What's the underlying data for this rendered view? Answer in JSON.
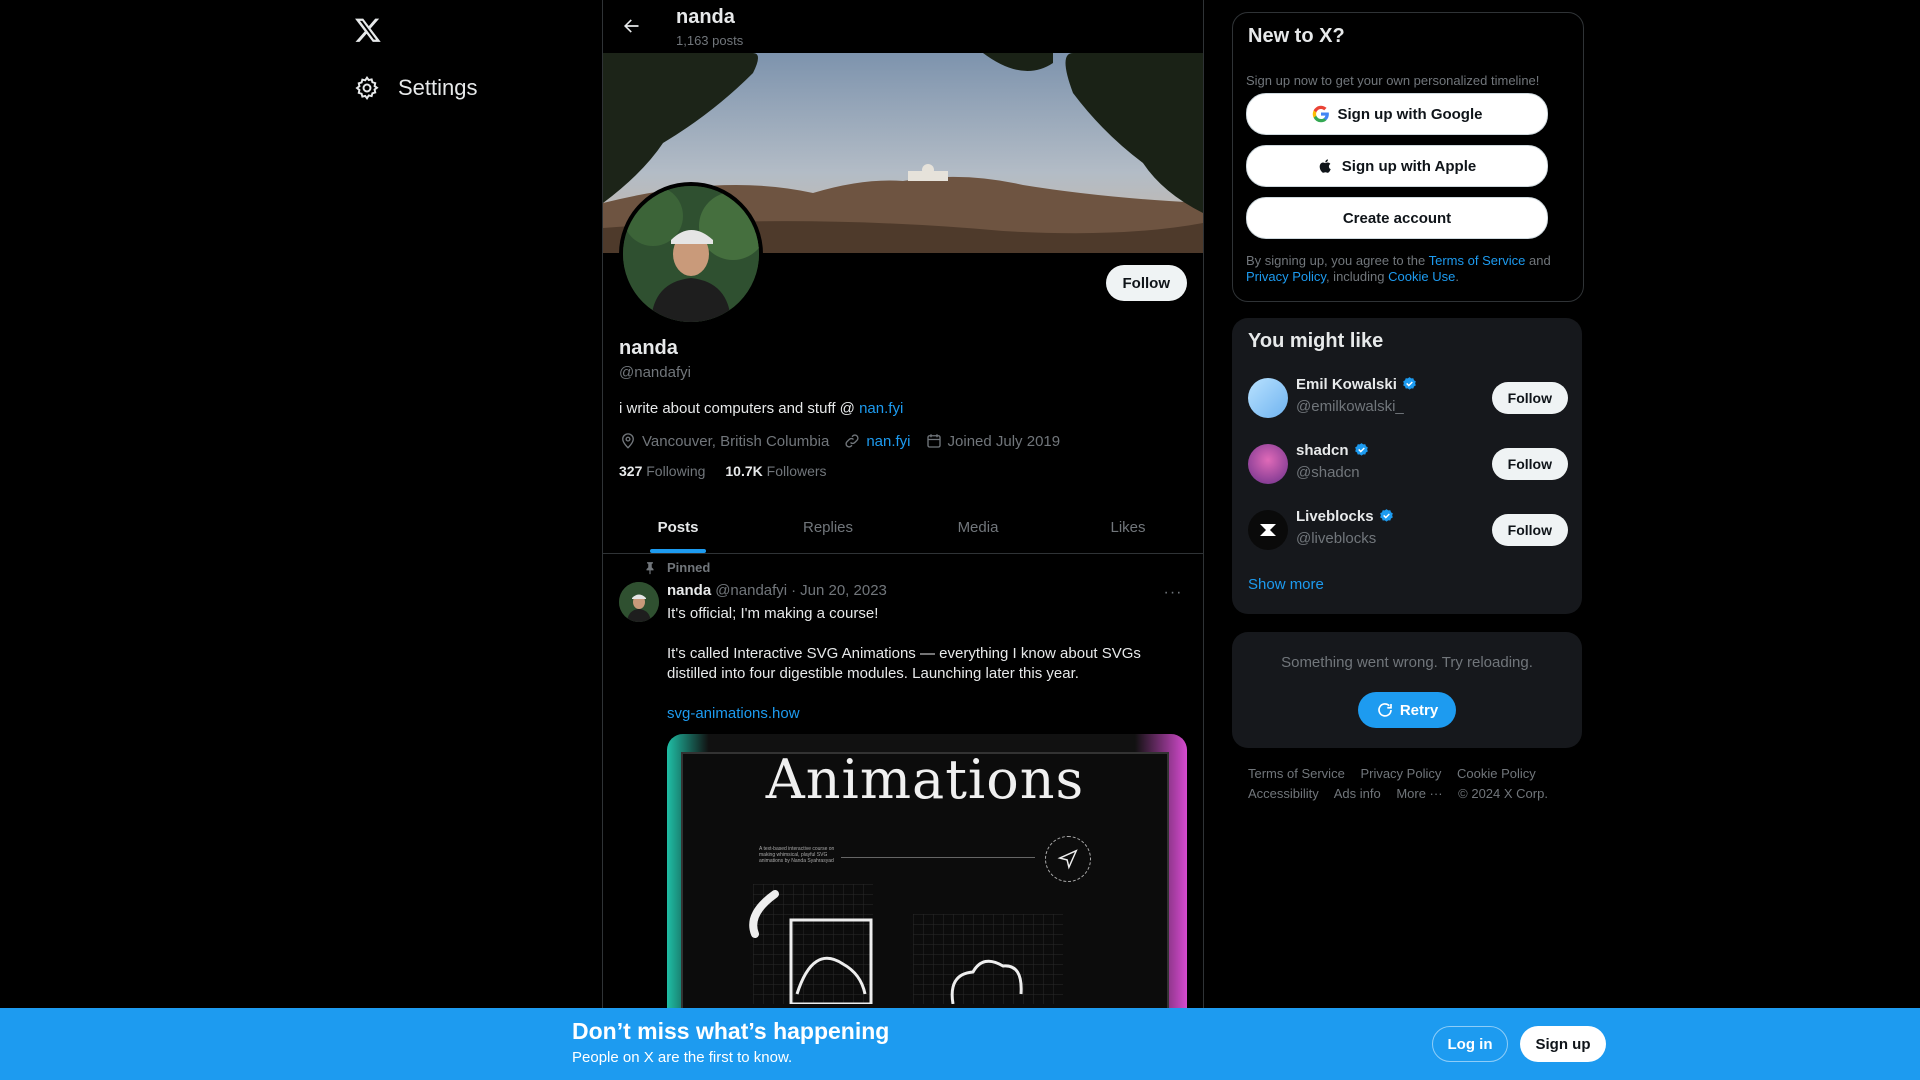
{
  "nav": {
    "logo": "X",
    "settings_label": "Settings"
  },
  "topbar": {
    "name": "nanda",
    "posts_count": "1,163 posts"
  },
  "profile": {
    "follow_label": "Follow",
    "name": "nanda",
    "handle": "@nandafyi",
    "bio_text": "i write about computers and stuff @ ",
    "bio_link": "nan.fyi",
    "location": "Vancouver, British Columbia",
    "website": "nan.fyi",
    "joined": "Joined July 2019",
    "following_count": "327",
    "following_label": "Following",
    "followers_count": "10.7K",
    "followers_label": "Followers"
  },
  "tabs": [
    {
      "label": "Posts"
    },
    {
      "label": "Replies"
    },
    {
      "label": "Media"
    },
    {
      "label": "Likes"
    }
  ],
  "post": {
    "pinned_label": "Pinned",
    "author": "nanda",
    "handle": "@nandafyi",
    "separator": "·",
    "date": "Jun 20, 2023",
    "more": "···",
    "line1": "It's official; I'm making a course!",
    "line2": "It's called Interactive SVG Animations — everything I know about SVGs distilled into four digestible modules. Launching later this year.",
    "link": "svg-animations.how",
    "media_title": "Animations",
    "media_caption": "A text-based interactive course on making whimsical, playful SVG animations by Nanda Syahrasyad"
  },
  "new_to_x": {
    "title": "New to X?",
    "subtitle": "Sign up now to get your own personalized timeline!",
    "google": "Sign up with Google",
    "apple": "Sign up with Apple",
    "create": "Create account",
    "terms_prefix": "By signing up, you agree to the ",
    "terms_link": "Terms of Service",
    "terms_and": " and ",
    "privacy_link": "Privacy Policy",
    "terms_including": ", including ",
    "cookie_link": "Cookie Use",
    "terms_end": "."
  },
  "might_like": {
    "title": "You might like",
    "users": [
      {
        "name": "Emil Kowalski",
        "handle": "@emilkowalski_",
        "follow": "Follow"
      },
      {
        "name": "shadcn",
        "handle": "@shadcn",
        "follow": "Follow"
      },
      {
        "name": "Liveblocks",
        "handle": "@liveblocks",
        "follow": "Follow"
      }
    ],
    "show_more": "Show more"
  },
  "error_card": {
    "message": "Something went wrong. Try reloading.",
    "retry": "Retry"
  },
  "footer": {
    "links": [
      "Terms of Service",
      "Privacy Policy",
      "Cookie Policy",
      "Accessibility",
      "Ads info",
      "More ···",
      "© 2024 X Corp."
    ]
  },
  "bottom_bar": {
    "title": "Don’t miss what’s happening",
    "subtitle": "People on X are the first to know.",
    "login": "Log in",
    "signup": "Sign up"
  },
  "colors": {
    "accent": "#1d9bf0",
    "background": "#000000",
    "card": "#16181c",
    "border": "#2f3336",
    "muted": "#71767b"
  }
}
